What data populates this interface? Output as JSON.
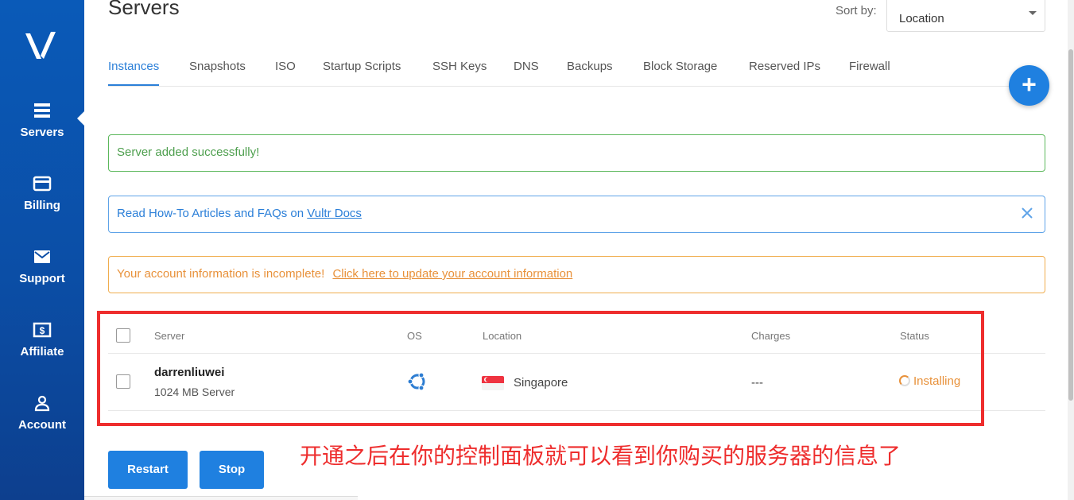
{
  "sidebar": {
    "logo": "vultr-logo-icon",
    "items": [
      {
        "label": "Servers",
        "icon": "servers-icon",
        "active": true
      },
      {
        "label": "Billing",
        "icon": "credit-card-icon",
        "active": false
      },
      {
        "label": "Support",
        "icon": "envelope-icon",
        "active": false
      },
      {
        "label": "Affiliate",
        "icon": "dollar-icon",
        "active": false
      },
      {
        "label": "Account",
        "icon": "user-icon",
        "active": false
      }
    ]
  },
  "header": {
    "title": "Servers",
    "sort_label": "Sort by:",
    "sort_value": "Location"
  },
  "tabs": [
    {
      "label": "Instances",
      "active": true
    },
    {
      "label": "Snapshots"
    },
    {
      "label": "ISO"
    },
    {
      "label": "Startup Scripts"
    },
    {
      "label": "SSH Keys"
    },
    {
      "label": "DNS"
    },
    {
      "label": "Backups"
    },
    {
      "label": "Block Storage"
    },
    {
      "label": "Reserved IPs"
    },
    {
      "label": "Firewall"
    }
  ],
  "fab": {
    "label": "+"
  },
  "alerts": {
    "success": "Server added successfully!",
    "info_text": "Read How-To Articles and FAQs on ",
    "info_link": "Vultr Docs",
    "warning_text": "Your account information is incomplete!",
    "warning_link": "Click here to update your account information"
  },
  "table": {
    "headers": {
      "server": "Server",
      "os": "OS",
      "location": "Location",
      "charges": "Charges",
      "status": "Status"
    },
    "rows": [
      {
        "name": "darrenliuwei",
        "plan": "1024 MB Server",
        "os_icon": "ubuntu-icon",
        "location": "Singapore",
        "flag": "singapore-flag-icon",
        "charges": "---",
        "status": "Installing"
      }
    ]
  },
  "actions": {
    "restart": "Restart",
    "stop": "Stop"
  },
  "annotation": "开通之后在你的控制面板就可以看到你购买的服务器的信息了",
  "colors": {
    "sidebar": "#0b4ea6",
    "accent": "#1f80e0",
    "success": "#5cb85c",
    "warning": "#f0ad4e",
    "annotation": "#ee2d2d"
  }
}
